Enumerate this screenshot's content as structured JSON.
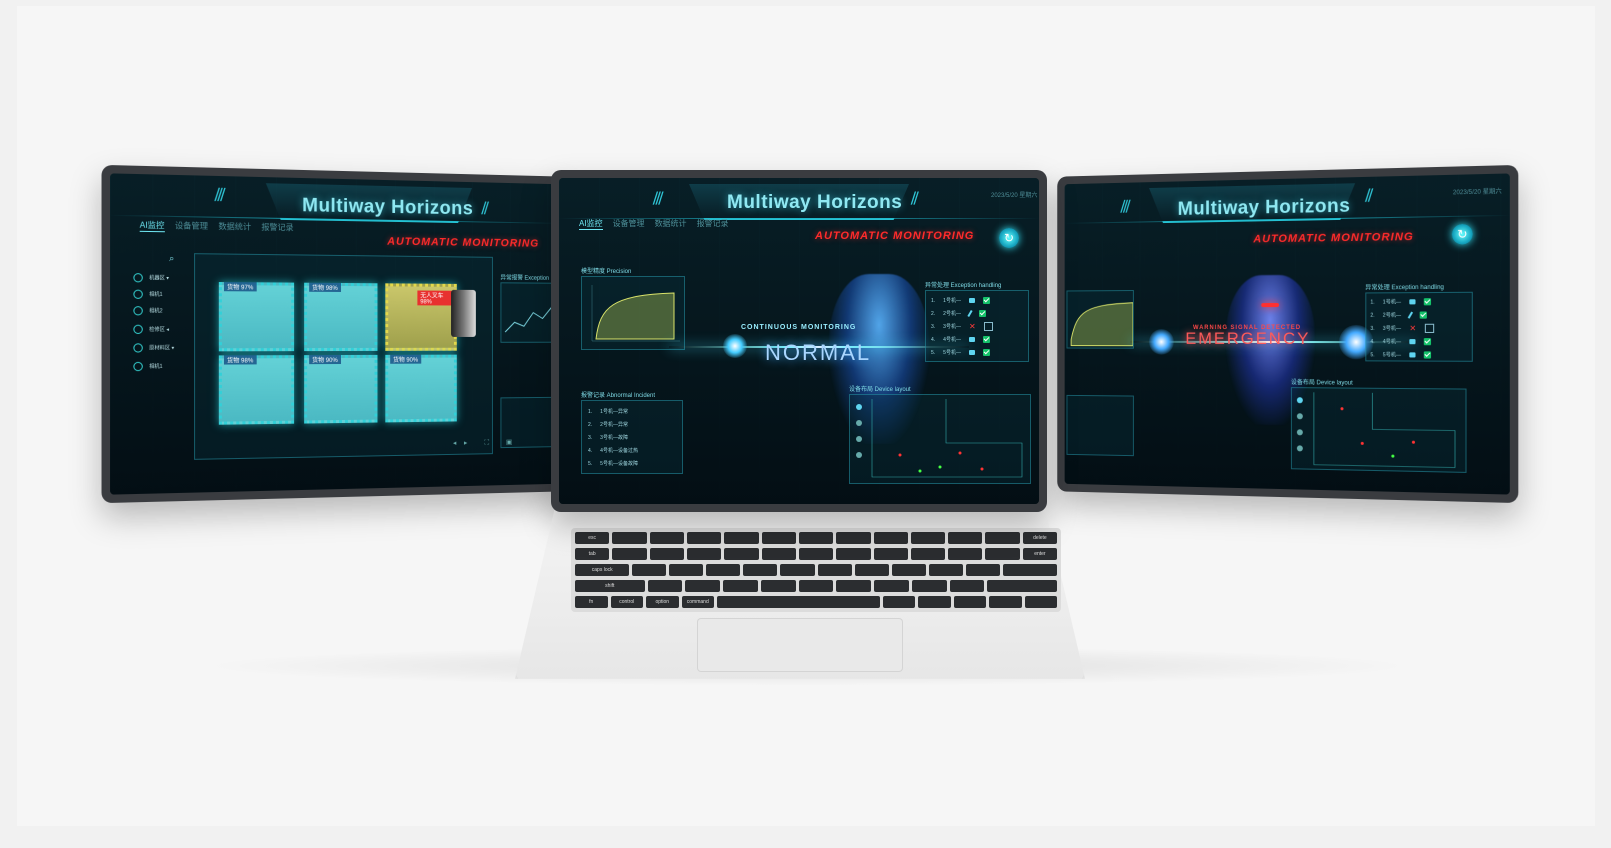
{
  "app": {
    "title": "Multiway Horizons",
    "subtitle": "AUTOMATIC MONITORING",
    "accent": "#27c3d4",
    "alert_color": "#ff2b2b",
    "date_text": "2023/5/20 星期六"
  },
  "nav": {
    "items": [
      "AI监控",
      "设备管理",
      "数据统计",
      "报警记录"
    ]
  },
  "left_screen": {
    "sidebar": [
      "机器区 ▾",
      "相机1",
      "相机2",
      "检修区 ◂",
      "原材料区 ▾",
      "相机1"
    ],
    "cameras": [
      {
        "label": "货物 97%"
      },
      {
        "label": "货物 98%"
      },
      {
        "label": "无人叉车 98%"
      },
      {
        "label": "货物 98%"
      },
      {
        "label": "货物 90%"
      },
      {
        "label": "货物 90%"
      }
    ],
    "warn_tag": "无人叉车 98%",
    "right_panel_title": "异常报警 Exception"
  },
  "center_screen": {
    "panel_curve_title": "模型精度 Precision",
    "panel_record_title": "报警记录 Abnormal Incident",
    "records": [
      "1号机—异常",
      "2号机—异常",
      "3号机—故障",
      "4号机—设备过热",
      "5号机—设备故障"
    ],
    "record_nums": [
      "1.",
      "2.",
      "3.",
      "4.",
      "5."
    ],
    "status_small": "CONTINUOUS MONITORING",
    "status_big": "NORMAL",
    "exception_title": "异常处理 Exception handling",
    "exceptions": [
      "1号机—",
      "2号机—",
      "3号机—",
      "4号机—",
      "5号机—"
    ],
    "device_title": "设备布局 Device layout"
  },
  "right_screen": {
    "status_small": "WARNING SIGNAL DETECTED",
    "status_big": "EMERGENCY",
    "exception_title": "异常处理 Exception handling",
    "exceptions": [
      "1号机—",
      "2号机—",
      "3号机—",
      "4号机—",
      "5号机—"
    ],
    "device_title": "设备布局 Device layout"
  },
  "keyboard": {
    "labels": [
      "esc",
      "tab",
      "caps lock",
      "shift",
      "fn",
      "control",
      "option",
      "command",
      "delete",
      "enter"
    ]
  }
}
